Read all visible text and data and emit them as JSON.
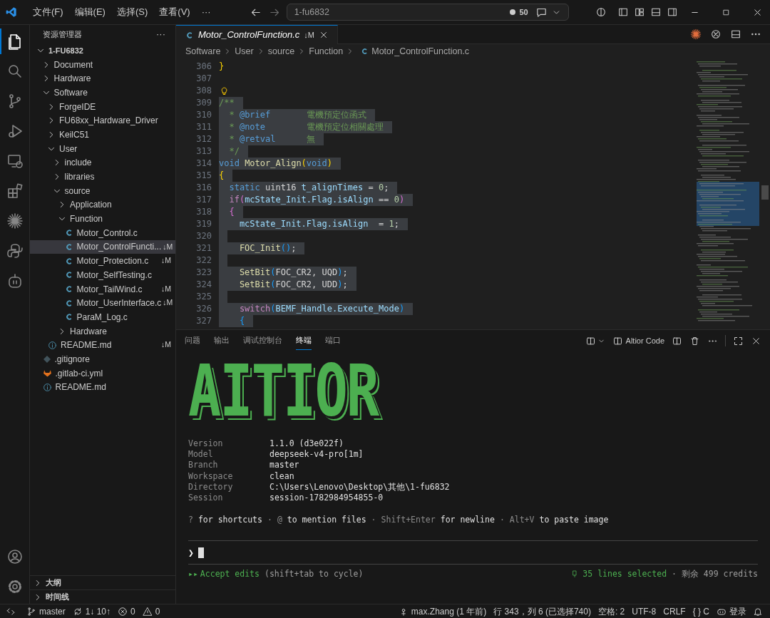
{
  "title_bar": {
    "menus": [
      "文件(F)",
      "编辑(E)",
      "选择(S)",
      "查看(V)",
      "···"
    ],
    "command_center": "1-fu6832",
    "count": "50"
  },
  "activity_bar": {
    "top": [
      {
        "kind": "files",
        "selected": true
      },
      {
        "kind": "search",
        "selected": false
      },
      {
        "kind": "branch",
        "selected": false
      },
      {
        "kind": "debug",
        "selected": false
      },
      {
        "kind": "remote",
        "selected": false
      },
      {
        "kind": "extensions",
        "selected": false
      },
      {
        "kind": "sparkle",
        "selected": false
      },
      {
        "kind": "python",
        "selected": false
      },
      {
        "kind": "robot",
        "selected": false
      }
    ],
    "bottom": [
      {
        "kind": "account"
      },
      {
        "kind": "gear"
      }
    ]
  },
  "sidebar": {
    "title": "资源管理器",
    "more": "···",
    "tree": [
      {
        "label": "1-FU6832",
        "kind": "root",
        "expanded": true,
        "children": [
          {
            "label": "Document",
            "kind": "folder",
            "expanded": false
          },
          {
            "label": "Hardware",
            "kind": "folder",
            "expanded": false
          },
          {
            "label": "Software",
            "kind": "folder",
            "expanded": true,
            "children": [
              {
                "label": "ForgeIDE",
                "kind": "folder",
                "expanded": false
              },
              {
                "label": "FU68xx_Hardware_Driver",
                "kind": "folder",
                "expanded": false
              },
              {
                "label": "KeilC51",
                "kind": "folder",
                "expanded": false
              },
              {
                "label": "User",
                "kind": "folder",
                "expanded": true,
                "children": [
                  {
                    "label": "include",
                    "kind": "folder",
                    "expanded": false
                  },
                  {
                    "label": "libraries",
                    "kind": "folder",
                    "expanded": false
                  },
                  {
                    "label": "source",
                    "kind": "folder",
                    "expanded": true,
                    "children": [
                      {
                        "label": "Application",
                        "kind": "folder",
                        "expanded": false
                      },
                      {
                        "label": "Function",
                        "kind": "folder",
                        "expanded": true,
                        "children": [
                          {
                            "label": "Motor_Control.c",
                            "kind": "c",
                            "selected": false
                          },
                          {
                            "label": "Motor_ControlFuncti...",
                            "kind": "c",
                            "selected": true,
                            "badge": "↓M"
                          },
                          {
                            "label": "Motor_Protection.c",
                            "kind": "c",
                            "selected": false,
                            "badge": "↓M"
                          },
                          {
                            "label": "Motor_SelfTesting.c",
                            "kind": "c",
                            "selected": false
                          },
                          {
                            "label": "Motor_TailWind.c",
                            "kind": "c",
                            "selected": false,
                            "badge": "↓M"
                          },
                          {
                            "label": "Motor_UserInterface.c",
                            "kind": "c",
                            "selected": false,
                            "badge": "↓M"
                          },
                          {
                            "label": "ParaM_Log.c",
                            "kind": "c",
                            "selected": false
                          }
                        ]
                      },
                      {
                        "label": "Hardware",
                        "kind": "folder",
                        "expanded": false
                      }
                    ]
                  }
                ]
              },
              {
                "label": "README.md",
                "kind": "info",
                "selected": false,
                "badge": "↓M"
              }
            ]
          },
          {
            "label": ".gitignore",
            "kind": "git",
            "selected": false
          },
          {
            "label": ".gitlab-ci.yml",
            "kind": "gitlab",
            "selected": false
          },
          {
            "label": "README.md",
            "kind": "info",
            "selected": false
          }
        ]
      }
    ],
    "sections": [
      {
        "label": "大纲",
        "expanded": false
      },
      {
        "label": "时间线",
        "expanded": false
      }
    ]
  },
  "editor": {
    "tab": {
      "label": "Motor_ControlFunction.c",
      "badge": "↓M"
    },
    "breadcrumb": [
      "Software",
      "User",
      "source",
      "Function",
      "Motor_ControlFunction.c"
    ],
    "lines": [
      {
        "number": "306",
        "selected": false,
        "tokens": [
          {
            "kind": "brace1",
            "text": "}"
          }
        ]
      },
      {
        "number": "307",
        "selected": false
      },
      {
        "number": "308",
        "selected": false,
        "lightbulb": true
      },
      {
        "number": "309",
        "selected": true,
        "tokens": [
          {
            "kind": "comment",
            "text": "/**"
          }
        ]
      },
      {
        "number": "310",
        "selected": true,
        "tokens": [
          {
            "kind": "comment",
            "text": "  * "
          },
          {
            "kind": "tag",
            "text": "@brief"
          },
          {
            "kind": "comment",
            "text": "       電機預定位函式"
          }
        ]
      },
      {
        "number": "311",
        "selected": true,
        "tokens": [
          {
            "kind": "comment",
            "text": "  * "
          },
          {
            "kind": "tag",
            "text": "@note"
          },
          {
            "kind": "comment",
            "text": "        電機預定位相關處理"
          }
        ]
      },
      {
        "number": "312",
        "selected": true,
        "tokens": [
          {
            "kind": "comment",
            "text": "  * "
          },
          {
            "kind": "tag",
            "text": "@retval"
          },
          {
            "kind": "comment",
            "text": "      無"
          }
        ]
      },
      {
        "number": "313",
        "selected": true,
        "tokens": [
          {
            "kind": "comment",
            "text": "  */"
          }
        ]
      },
      {
        "number": "314",
        "selected": true,
        "tokens": [
          {
            "kind": "keyword",
            "text": "void"
          },
          {
            "kind": "func",
            "text": " Motor_Align"
          },
          {
            "kind": "brace1",
            "text": "("
          },
          {
            "kind": "keyword",
            "text": "void"
          },
          {
            "kind": "brace1",
            "text": ")"
          }
        ]
      },
      {
        "number": "315",
        "selected": true,
        "tokens": [
          {
            "kind": "brace1",
            "text": "{"
          }
        ]
      },
      {
        "number": "316",
        "selected": true,
        "tokens": [
          {
            "kind": "keyword",
            "text": "  static"
          },
          {
            "kind": "plain",
            "text": " uint16 "
          },
          {
            "kind": "var",
            "text": "t_alignTimes"
          },
          {
            "kind": "plain",
            "text": " = "
          },
          {
            "kind": "num",
            "text": "0"
          },
          {
            "kind": "plain",
            "text": ";"
          }
        ]
      },
      {
        "number": "317",
        "selected": true,
        "tokens": [
          {
            "kind": "control",
            "text": "  if"
          },
          {
            "kind": "brace2",
            "text": "("
          },
          {
            "kind": "var",
            "text": "mcState_Init.Flag.isAlign"
          },
          {
            "kind": "plain",
            "text": " == "
          },
          {
            "kind": "num",
            "text": "0"
          },
          {
            "kind": "brace2",
            "text": ")"
          }
        ]
      },
      {
        "number": "318",
        "selected": true,
        "tokens": [
          {
            "kind": "brace2",
            "text": "  {"
          }
        ]
      },
      {
        "number": "319",
        "selected": true,
        "tokens": [
          {
            "kind": "var",
            "text": "    mcState_Init.Flag.isAlign"
          },
          {
            "kind": "plain",
            "text": "  = "
          },
          {
            "kind": "num",
            "text": "1"
          },
          {
            "kind": "plain",
            "text": ";"
          }
        ]
      },
      {
        "number": "320",
        "selected": true
      },
      {
        "number": "321",
        "selected": true,
        "tokens": [
          {
            "kind": "func",
            "text": "    FOC_Init"
          },
          {
            "kind": "brace3",
            "text": "()"
          },
          {
            "kind": "plain",
            "text": ";"
          }
        ]
      },
      {
        "number": "322",
        "selected": true
      },
      {
        "number": "323",
        "selected": true,
        "tokens": [
          {
            "kind": "func",
            "text": "    SetBit"
          },
          {
            "kind": "brace3",
            "text": "("
          },
          {
            "kind": "plain",
            "text": "FOC_CR2, UQD"
          },
          {
            "kind": "brace3",
            "text": ")"
          },
          {
            "kind": "plain",
            "text": ";"
          }
        ]
      },
      {
        "number": "324",
        "selected": true,
        "tokens": [
          {
            "kind": "func",
            "text": "    SetBit"
          },
          {
            "kind": "brace3",
            "text": "("
          },
          {
            "kind": "plain",
            "text": "FOC_CR2, UDD"
          },
          {
            "kind": "brace3",
            "text": ")"
          },
          {
            "kind": "plain",
            "text": ";"
          }
        ]
      },
      {
        "number": "325",
        "selected": true
      },
      {
        "number": "326",
        "selected": true,
        "tokens": [
          {
            "kind": "control",
            "text": "    switch"
          },
          {
            "kind": "brace3",
            "text": "("
          },
          {
            "kind": "var",
            "text": "BEMF_Handle.Execute_Mode"
          },
          {
            "kind": "brace3",
            "text": ")"
          }
        ]
      },
      {
        "number": "327",
        "selected": true,
        "tokens": [
          {
            "kind": "brace3",
            "text": "    {"
          }
        ]
      }
    ]
  },
  "panel": {
    "tabs": [
      {
        "label": "问题",
        "selected": false
      },
      {
        "label": "输出",
        "selected": false
      },
      {
        "label": "调试控制台",
        "selected": false
      },
      {
        "label": "终端",
        "selected": true
      },
      {
        "label": "端口",
        "selected": false
      }
    ],
    "terminal_name": "Altior Code",
    "banner": "AITIOR",
    "info": [
      {
        "label": "Version",
        "value": "1.1.0 (d3e022f)"
      },
      {
        "label": "Model",
        "value": "deepseek-v4-pro[1m]"
      },
      {
        "label": "Branch",
        "value": "master"
      },
      {
        "label": "Workspace",
        "value": "clean"
      },
      {
        "label": "Directory",
        "value": "C:\\Users\\Lenovo\\Desktop\\其他\\1-fu6832"
      },
      {
        "label": "Session",
        "value": "session-1782984954855-0"
      }
    ],
    "hint": [
      {
        "text": "?",
        "dim": true
      },
      {
        "text": "for shortcuts",
        "dim": false
      },
      {
        "text": "·",
        "dim": true
      },
      {
        "text": "@",
        "dim": true
      },
      {
        "text": "to mention files",
        "dim": false
      },
      {
        "text": "·",
        "dim": true
      },
      {
        "text": "Shift+Enter",
        "dim": true
      },
      {
        "text": "for newline",
        "dim": false
      },
      {
        "text": "·",
        "dim": true
      },
      {
        "text": "Alt+V",
        "dim": true
      },
      {
        "text": "to paste image",
        "dim": false
      }
    ],
    "prompt": "❯",
    "mode": {
      "arrows": "▸▸",
      "label": "Accept edits",
      "hint": "(shift+tab to cycle)"
    },
    "selection": "35 lines selected",
    "credits": "· 剩余 499 credits"
  },
  "status_bar": {
    "left": [
      {
        "kind": "remote"
      },
      {
        "kind": "branch",
        "text": "master"
      },
      {
        "kind": "sync",
        "text": "1↓ 10↑"
      },
      {
        "kind": "error",
        "text": "0"
      },
      {
        "kind": "warning",
        "text": "0"
      }
    ],
    "right": [
      {
        "kind": "person",
        "text": "max.Zhang (1 年前)"
      },
      {
        "kind": "text",
        "text": "行 343，列 6 (已选择740)"
      },
      {
        "kind": "text",
        "text": "空格: 2"
      },
      {
        "kind": "text",
        "text": "UTF-8"
      },
      {
        "kind": "text",
        "text": "CRLF"
      },
      {
        "kind": "text",
        "text": "{ } C"
      },
      {
        "kind": "copilot",
        "text": "登录"
      },
      {
        "kind": "bell"
      }
    ]
  }
}
